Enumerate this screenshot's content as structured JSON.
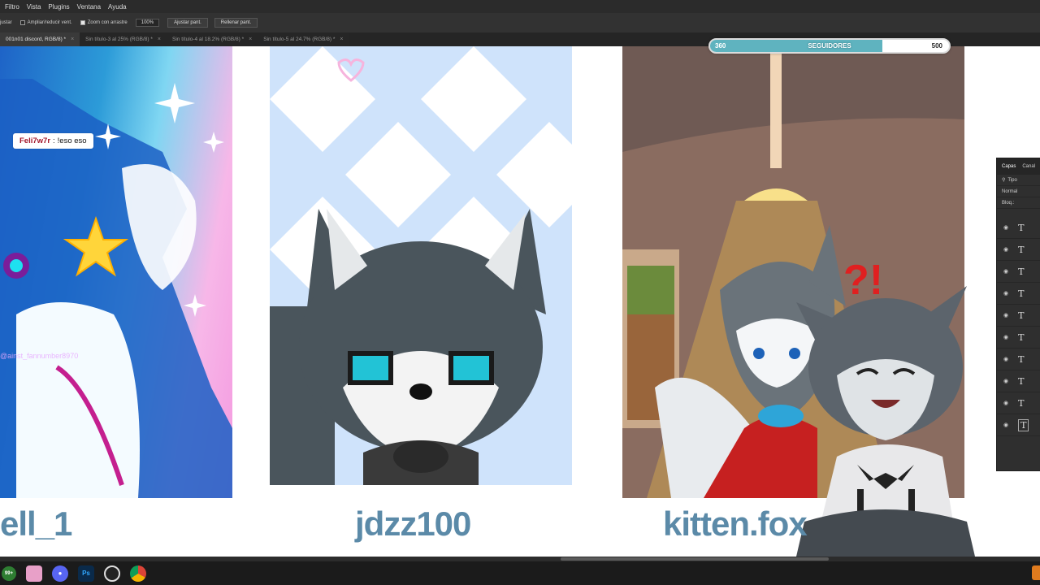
{
  "menu": {
    "items": [
      "Filtro",
      "Vista",
      "Plugins",
      "Ventana",
      "Ayuda"
    ]
  },
  "options": {
    "fit_label": "justar",
    "resize_label": "Ampliar/reducir vent.",
    "resize_checked": false,
    "scrubby_zoom_label": "Zoom con arrastre",
    "scrubby_zoom_checked": true,
    "zoom_value": "100%",
    "fit_screen_label": "Ajustar pant.",
    "fill_screen_label": "Rellenar pant."
  },
  "tabs": [
    {
      "label": "001n01 discord, RGB/8) *",
      "active": true
    },
    {
      "label": "Sin título-3 al 25% (RGB/8) *",
      "active": false
    },
    {
      "label": "Sin título-4 al 18.2% (RGB/8) *",
      "active": false
    },
    {
      "label": "Sin título-5 al 24.7% (RGB/8) *",
      "active": false
    }
  ],
  "tab_close_glyph": "×",
  "canvas": {
    "names": [
      "ell_1",
      "jdzz100",
      "kitten.fox"
    ],
    "watermark_text": "@ainst_fannumber8970",
    "exclamation": "?!"
  },
  "chat": {
    "user": "Feli7w7r",
    "separator": ":",
    "message": "!eso eso"
  },
  "follower_goal": {
    "title": "SEGUIDORES",
    "current": "360",
    "max": "500",
    "progress": 0.72,
    "fill_color": "#5fb3bf"
  },
  "layers_panel": {
    "tabs": [
      "Capas",
      "Canal"
    ],
    "filter_label": "Tipo",
    "blend_mode": "Normal",
    "lock_label": "Bloq.:",
    "layer_count": 10,
    "layer_icon": "text-layer-icon"
  },
  "taskbar": {
    "badge_text": "99+",
    "apps": [
      "notification-badge-icon",
      "pinned-app-icon",
      "discord-icon",
      "photoshop-icon",
      "obs-icon",
      "chrome-icon"
    ],
    "ps_label": "Ps"
  },
  "colors": {
    "ps_bg": "#323232",
    "name_text": "#5b8aa8",
    "chat_user": "#a3162a",
    "follower_fill": "#5fb3bf"
  }
}
